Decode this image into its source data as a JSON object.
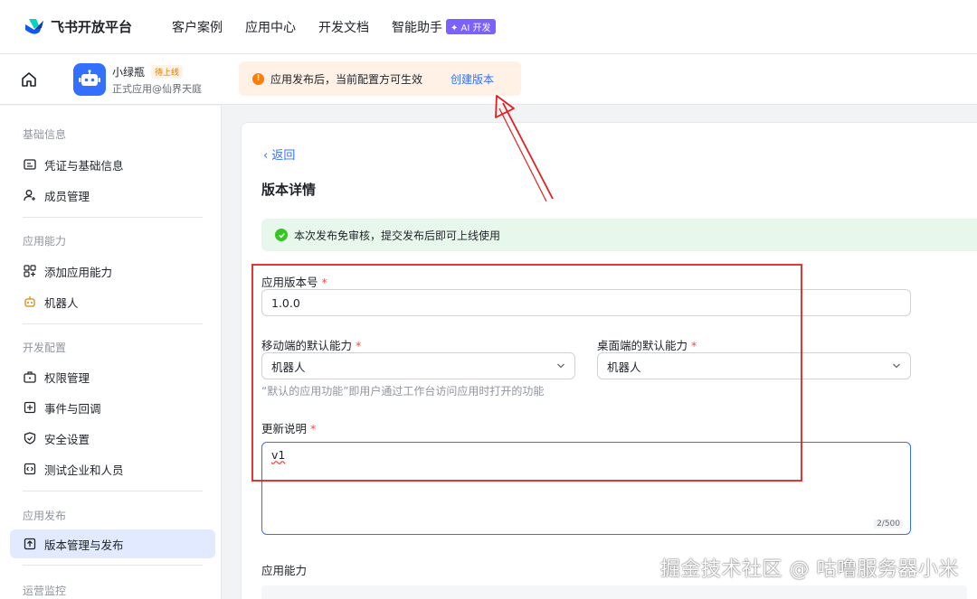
{
  "topnav": {
    "brand": "飞书开放平台",
    "links": [
      "客户案例",
      "应用中心",
      "开发文档",
      "智能助手"
    ],
    "ai_badge": "✦ AI 开发"
  },
  "appbar": {
    "app_name": "小绿瓶",
    "status": "待上线",
    "app_sub": "正式应用@仙界天庭",
    "notice": "应用发布后，当前配置方可生效",
    "notice_link": "创建版本"
  },
  "sidebar": {
    "sections": [
      {
        "title": "基础信息",
        "items": [
          "凭证与基础信息",
          "成员管理"
        ]
      },
      {
        "title": "应用能力",
        "items": [
          "添加应用能力",
          "机器人"
        ]
      },
      {
        "title": "开发配置",
        "items": [
          "权限管理",
          "事件与回调",
          "安全设置",
          "测试企业和人员"
        ]
      },
      {
        "title": "应用发布",
        "items": [
          "版本管理与发布"
        ]
      },
      {
        "title": "运营监控",
        "items": []
      }
    ],
    "active_item": "版本管理与发布"
  },
  "main": {
    "back": "返回",
    "title": "版本详情",
    "success": "本次发布免审核，提交发布后即可上线使用",
    "version_label": "应用版本号",
    "version_value": "1.0.0",
    "mobile_label": "移动端的默认能力",
    "mobile_value": "机器人",
    "desktop_label": "桌面端的默认能力",
    "desktop_value": "机器人",
    "hint": "“默认的应用功能”即用户通过工作台访问应用时打开的功能",
    "notes_label": "更新说明",
    "notes_value": "v1",
    "notes_counter": "2/500",
    "capability_label": "应用能力",
    "required_mark": "*"
  },
  "watermark": "掘金技术社区 @ 咕噜服务器小米",
  "colors": {
    "accent": "#3370ff",
    "annotation": "#e02020",
    "success_bg": "#e8f7ec",
    "notice_bg": "#fff1e6"
  }
}
